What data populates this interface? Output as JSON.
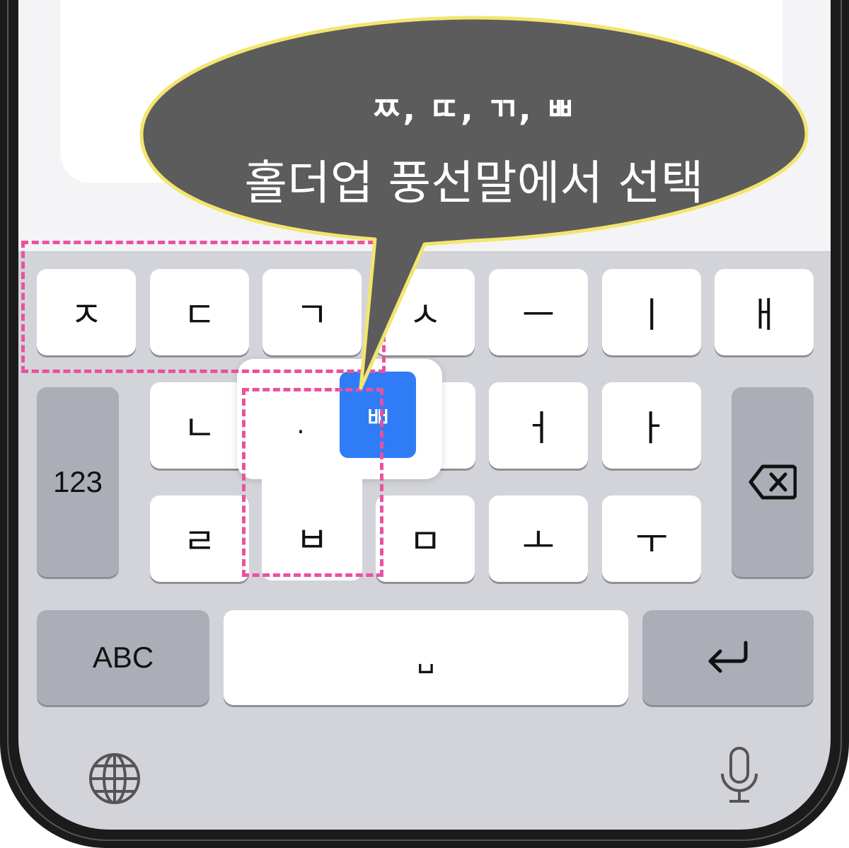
{
  "keyboard": {
    "row1": [
      "ㅈ",
      "ㄷ",
      "ㄱ",
      "ㅅ",
      "ㅡ",
      "ㅣ",
      "ㅐ"
    ],
    "row2": [
      "ㄴ",
      "ㅂ",
      "ㅓ",
      "ㅏ"
    ],
    "row3": [
      "ㄹ",
      "ㅂ",
      "ㅁ",
      "ㅗ",
      "ㅜ"
    ],
    "numbers_key": "123",
    "abc_key": "ABC",
    "space_key": "␣",
    "icons": {
      "delete": "delete-backspace-icon",
      "return": "return-arrow-icon",
      "globe": "globe-icon",
      "mic": "microphone-icon"
    }
  },
  "popup": {
    "options": [
      "·",
      "ㅃ"
    ],
    "selected": "ㅃ",
    "selected_color": "#2f7cf6"
  },
  "callout": {
    "line1": "ㅉ, ㄸ, ㄲ, ㅃ",
    "line2": "홀더업 풍선말에서 선택",
    "fill_color": "#5c5c5c",
    "border_color": "#f3e56f"
  },
  "highlight_color": "#e9529e"
}
